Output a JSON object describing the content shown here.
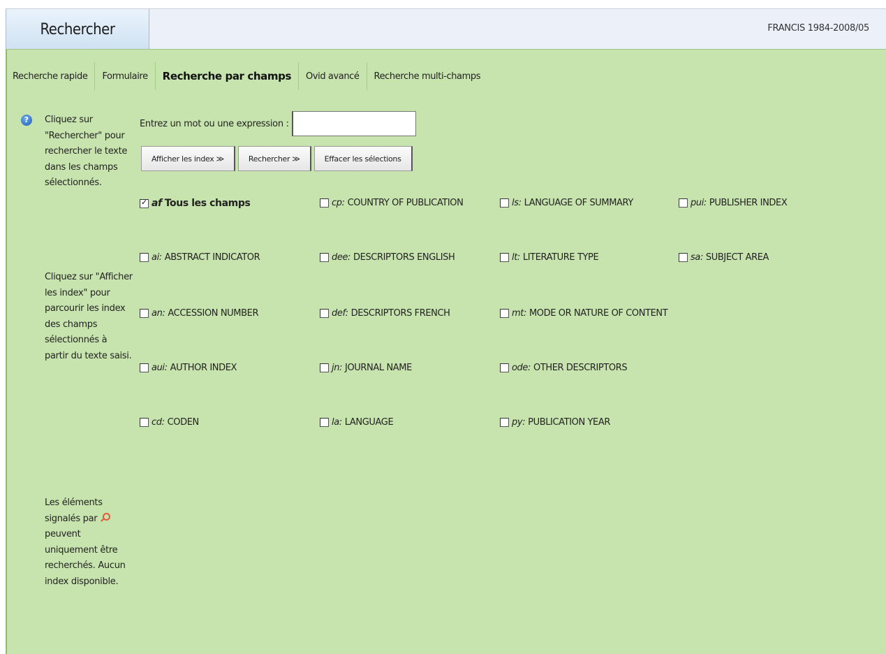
{
  "header": {
    "title": "Rechercher",
    "database": "FRANCIS 1984-2008/05"
  },
  "tabs": [
    {
      "label": "Recherche rapide"
    },
    {
      "label": "Formulaire"
    },
    {
      "label": "Recherche par champs",
      "active": true
    },
    {
      "label": "Ovid avancé"
    },
    {
      "label": "Recherche multi-champs"
    }
  ],
  "help": {
    "p1": "Cliquez sur \"Rechercher\" pour rechercher le texte dans les champs sélectionnés.",
    "p2": "Cliquez sur \"Afficher les index\" pour parcourir les index des champs sélectionnés à partir du texte saisi.",
    "p3_before": "Les éléments signalés par",
    "p3_after": "peuvent uniquement être recherchés. Aucun index disponible.",
    "icon": "help-icon",
    "search_icon": "magnifier-icon"
  },
  "search": {
    "label": "Entrez un mot ou une expression :",
    "value": ""
  },
  "buttons": {
    "show_index": "Afficher les index ≫",
    "search": "Rechercher ≫",
    "clear": "Effacer les sélections"
  },
  "fields": {
    "af": {
      "code": "af",
      "label": "Tous les champs",
      "checked": true
    },
    "cp": {
      "code": "cp:",
      "label": "COUNTRY OF PUBLICATION",
      "checked": false
    },
    "ls": {
      "code": "ls:",
      "label": "LANGUAGE OF SUMMARY",
      "checked": false
    },
    "pui": {
      "code": "pui:",
      "label": "PUBLISHER INDEX",
      "checked": false
    },
    "ai": {
      "code": "ai:",
      "label": "ABSTRACT INDICATOR",
      "checked": false
    },
    "dee": {
      "code": "dee:",
      "label": "DESCRIPTORS ENGLISH",
      "checked": false
    },
    "lt": {
      "code": "lt:",
      "label": "LITERATURE TYPE",
      "checked": false
    },
    "sa": {
      "code": "sa:",
      "label": "SUBJECT AREA",
      "checked": false
    },
    "an": {
      "code": "an:",
      "label": "ACCESSION NUMBER",
      "checked": false
    },
    "def": {
      "code": "def:",
      "label": "DESCRIPTORS FRENCH",
      "checked": false
    },
    "mt": {
      "code": "mt:",
      "label": "MODE OR NATURE OF CONTENT",
      "checked": false
    },
    "aui": {
      "code": "aui:",
      "label": "AUTHOR INDEX",
      "checked": false
    },
    "jn": {
      "code": "jn:",
      "label": "JOURNAL NAME",
      "checked": false
    },
    "ode": {
      "code": "ode:",
      "label": "OTHER DESCRIPTORS",
      "checked": false
    },
    "cd": {
      "code": "cd:",
      "label": "CODEN",
      "checked": false
    },
    "la": {
      "code": "la:",
      "label": "LANGUAGE",
      "checked": false
    },
    "py": {
      "code": "py:",
      "label": "PUBLICATION YEAR",
      "checked": false
    }
  },
  "colors": {
    "panel": "#c8e4ae",
    "header": "#ecf0f8",
    "tab_separator": "#9fcf82"
  }
}
